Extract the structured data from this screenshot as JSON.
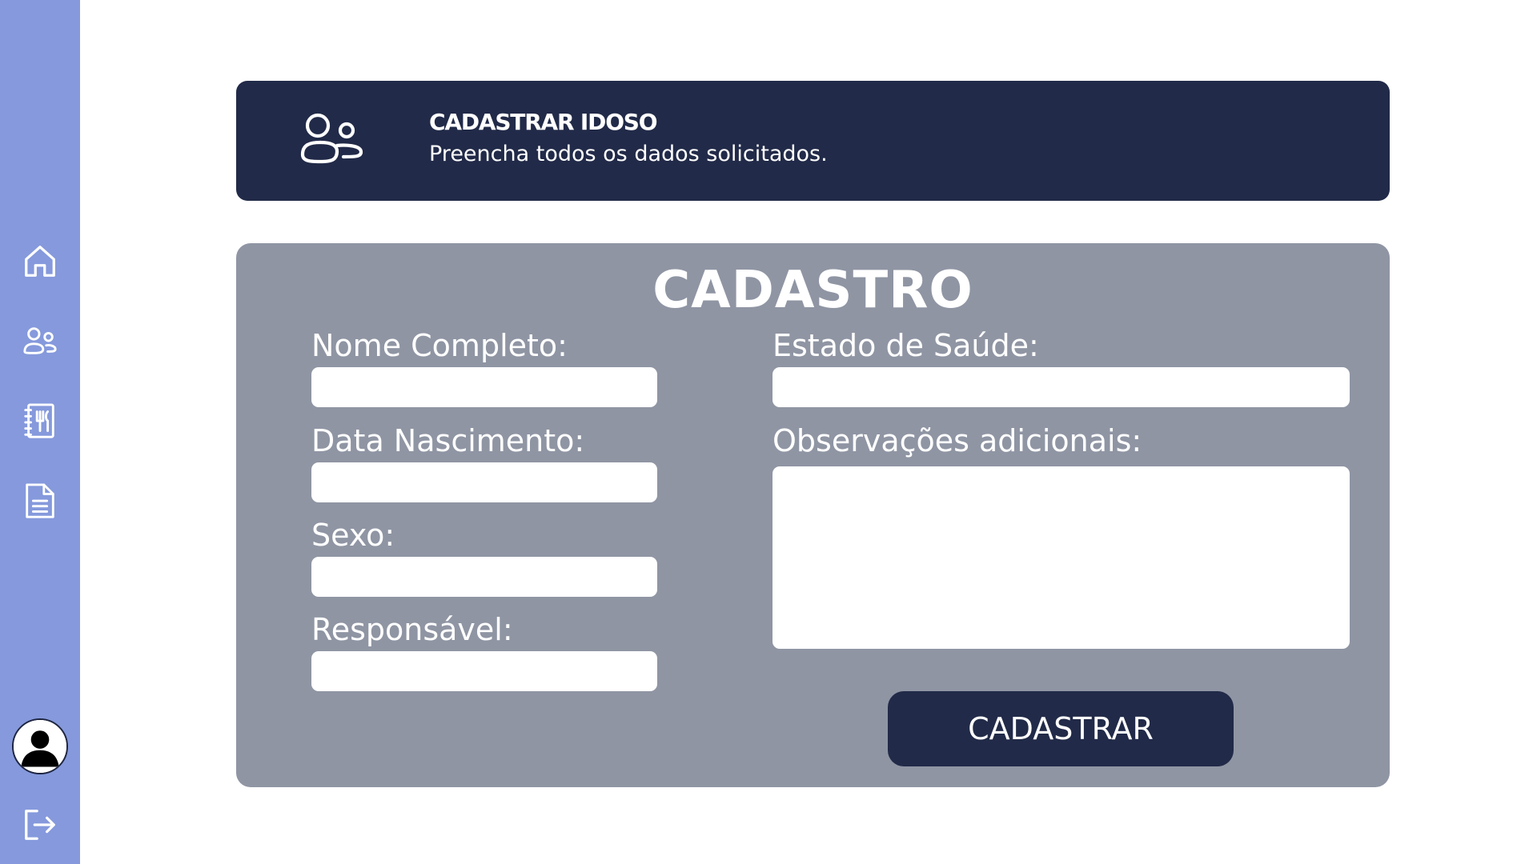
{
  "header": {
    "title": "CADASTRAR IDOSO",
    "subtitle": "Preencha todos os dados solicitados.",
    "icon": "users-icon"
  },
  "sidebar": {
    "items": [
      {
        "icon": "home-icon"
      },
      {
        "icon": "users-icon"
      },
      {
        "icon": "menu-book-icon"
      },
      {
        "icon": "document-icon"
      }
    ],
    "avatar_icon": "user-avatar-icon",
    "logout_icon": "logout-icon"
  },
  "form": {
    "title": "CADASTRO",
    "fields": {
      "nome": {
        "label": "Nome Completo:",
        "value": ""
      },
      "nascimento": {
        "label": "Data Nascimento:",
        "value": ""
      },
      "sexo": {
        "label": "Sexo:",
        "value": ""
      },
      "responsavel": {
        "label": "Responsável:",
        "value": ""
      },
      "saude": {
        "label": "Estado de Saúde:",
        "value": ""
      },
      "observacoes": {
        "label": "Observações adicionais:",
        "value": ""
      }
    },
    "submit_label": "CADASTRAR"
  },
  "colors": {
    "sidebar": "#8599dc",
    "navy": "#212a48",
    "card": "#8f95a3",
    "white": "#ffffff"
  }
}
